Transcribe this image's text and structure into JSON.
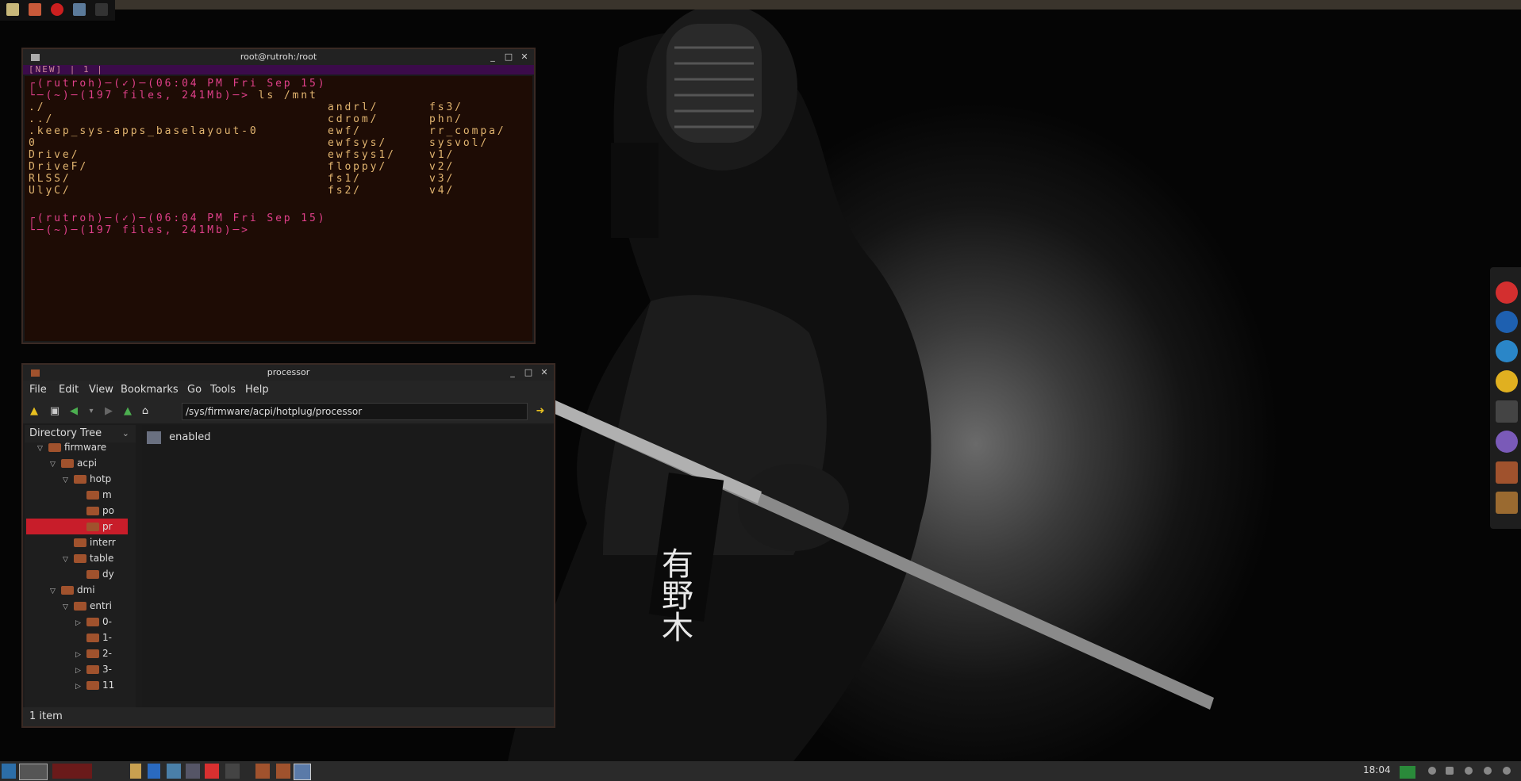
{
  "desktop": {
    "wallpaper_banner_text": "有野木"
  },
  "terminal": {
    "title": "root@rutroh:/root",
    "tab_text": "[NEW]  |  1  |",
    "prompt1": "┌(rutroh)─(✓)─(06:04 PM Fri Sep 15)",
    "prompt2": "└─(~)─(197 files, 241Mb)─>",
    "command": "ls /mnt",
    "listing_col1": [
      "./",
      "../",
      ".keep_sys-apps_baselayout-0",
      "0",
      "Drive/",
      "DriveF/",
      "RLSS/",
      "UlyC/"
    ],
    "listing_col2": [
      "andrl/",
      "cdrom/",
      "ewf/",
      "ewfsys/",
      "ewfsys1/",
      "floppy/",
      "fs1/",
      "fs2/"
    ],
    "listing_col3": [
      "fs3/",
      "phn/",
      "rr_compa/",
      "sysvol/",
      "v1/",
      "v2/",
      "v3/",
      "v4/"
    ],
    "prompt3": "┌(rutroh)─(✓)─(06:04 PM Fri Sep 15)",
    "prompt4": "└─(~)─(197 files, 241Mb)─>"
  },
  "filemanager": {
    "title": "processor",
    "menu": [
      "File",
      "Edit",
      "View",
      "Bookmarks",
      "Go",
      "Tools",
      "Help"
    ],
    "path": "/sys/firmware/acpi/hotplug/processor",
    "sidepane_mode": "Directory Tree",
    "tree": [
      {
        "label": "firmware",
        "level": 2,
        "expanded": true
      },
      {
        "label": "acpi",
        "level": 3,
        "expanded": true
      },
      {
        "label": "hotp",
        "level": 4,
        "expanded": true
      },
      {
        "label": "m",
        "level": 5,
        "expanded": null
      },
      {
        "label": "po",
        "level": 5,
        "expanded": null
      },
      {
        "label": "pr",
        "level": 5,
        "expanded": null,
        "selected": true
      },
      {
        "label": "interr",
        "level": 4,
        "expanded": null
      },
      {
        "label": "table",
        "level": 4,
        "expanded": true
      },
      {
        "label": "dy",
        "level": 5,
        "expanded": null
      },
      {
        "label": "dmi",
        "level": 3,
        "expanded": true
      },
      {
        "label": "entri",
        "level": 4,
        "expanded": true
      },
      {
        "label": "0-",
        "level": 5,
        "expanded": false
      },
      {
        "label": "1-",
        "level": 5,
        "expanded": null
      },
      {
        "label": "2-",
        "level": 5,
        "expanded": false
      },
      {
        "label": "3-",
        "level": 5,
        "expanded": false
      },
      {
        "label": "11",
        "level": 5,
        "expanded": false
      }
    ],
    "items": [
      {
        "name": "enabled"
      }
    ],
    "status": "1 item"
  },
  "panel": {
    "clock": "18:04"
  },
  "colors": {
    "terminal_prompt": "#e0408a",
    "terminal_text": "#e2b570",
    "terminal_tabbar": "#3b0b4a",
    "selection": "#c81d2a",
    "folder": "#a0522d"
  },
  "icons": {
    "dock": [
      "alarm-clock-icon",
      "firefox-icon",
      "media-player-icon",
      "cd-icon",
      "cursor-tool-icon",
      "pidgin-icon",
      "folder-icon",
      "trash-icon"
    ],
    "taskbar": [
      "menu-icon",
      "window-task-icon",
      "window-task-icon",
      "file-manager-icon",
      "storage-icon",
      "desktop-icon",
      "terminal-icon",
      "screenshot-icon",
      "folder-icon",
      "folder-icon",
      "window-icon"
    ]
  }
}
